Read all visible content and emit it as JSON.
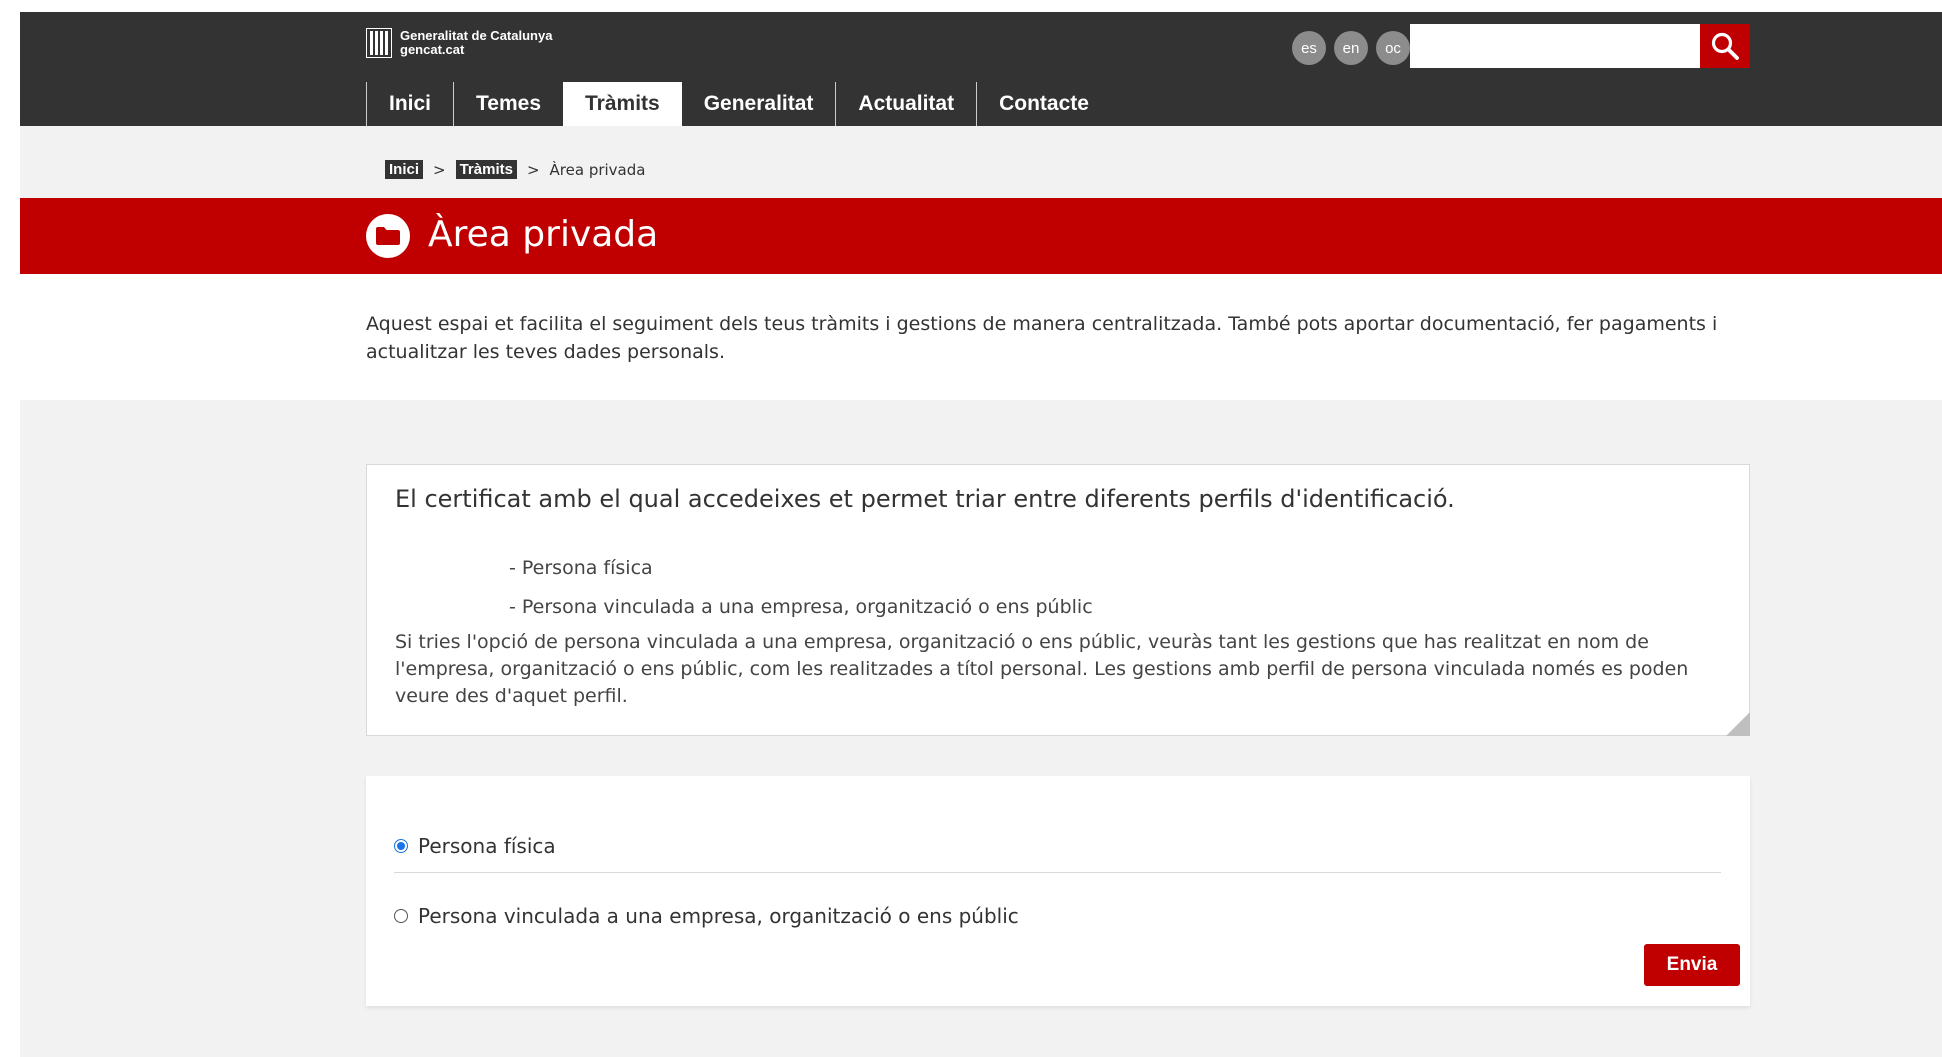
{
  "header": {
    "logo_line1": "Generalitat de Catalunya",
    "logo_line2": "gencat.cat",
    "languages": [
      "es",
      "en",
      "oc"
    ],
    "search": {
      "value": "",
      "placeholder": ""
    },
    "nav": [
      "Inici",
      "Temes",
      "Tràmits",
      "Generalitat",
      "Actualitat",
      "Contacte"
    ],
    "active_nav": "Tràmits"
  },
  "breadcrumb": {
    "items": [
      "Inici",
      "Tràmits"
    ],
    "current": "Àrea privada",
    "separator": ">"
  },
  "page": {
    "title": "Àrea privada",
    "intro": "Aquest espai et facilita el seguiment dels teus tràmits i gestions de manera centralitzada. També pots aportar documentació, fer pagaments i actualitzar les teves dades personals."
  },
  "info": {
    "title": "El certificat amb el qual accedeixes et permet triar entre diferents perfils d'identificació.",
    "options": [
      "- Persona física",
      "- Persona vinculada a una empresa, organització o ens públic"
    ],
    "description": "Si tries l'opció de persona vinculada a una empresa, organització o ens públic, veuràs tant les gestions que has realitzat en nom de l'empresa, organització o ens públic, com les realitzades a títol personal. Les gestions amb perfil de persona vinculada només es poden veure des d'aquet perfil."
  },
  "form": {
    "options": [
      {
        "label": "Persona física",
        "checked": true
      },
      {
        "label": "Persona vinculada a una empresa, organització o ens públic",
        "checked": false
      }
    ],
    "submit_label": "Envia"
  },
  "colors": {
    "header_bg": "#333333",
    "brand_red": "#c00000",
    "radio_blue": "#1a73e8",
    "page_bg": "#f2f2f2"
  }
}
